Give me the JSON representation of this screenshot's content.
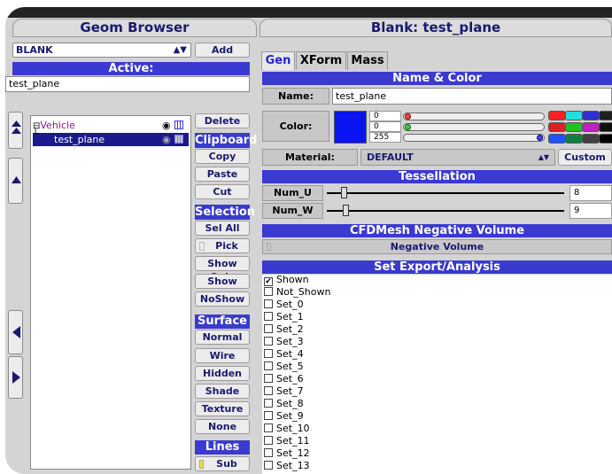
{
  "left_panel": {
    "title": "Geom Browser",
    "type_select": "BLANK",
    "add_label": "Add",
    "active_header": "Active:",
    "active_value": "test_plane",
    "tree": [
      {
        "label": "Vehicle"
      },
      {
        "label": "test_plane"
      }
    ],
    "delete_label": "Delete",
    "clipboard_header": "Clipboard",
    "copy_label": "Copy",
    "paste_label": "Paste",
    "cut_label": "Cut",
    "selection_header": "Selection",
    "sel_all_label": "Sel All",
    "pick_label": "Pick",
    "show_only_label": "Show Only",
    "show_label": "Show",
    "noshow_label": "NoShow",
    "surface_header": "Surface",
    "surface_select": "Normal",
    "wire_label": "Wire",
    "hidden_label": "Hidden",
    "shade_label": "Shade",
    "texture_label": "Texture",
    "none_label": "None",
    "lines_header": "Lines",
    "sub_label": "Sub"
  },
  "right_panel": {
    "title": "Blank: test_plane",
    "tabs": [
      "Gen",
      "XForm",
      "Mass"
    ],
    "name_color_header": "Name & Color",
    "name_label": "Name:",
    "name_value": "test_plane",
    "color_label": "Color:",
    "color_value": "#0a14f0",
    "rgb": [
      "0",
      "0",
      "255"
    ],
    "material_label": "Material:",
    "material_value": "DEFAULT",
    "custom_label": "Custom",
    "tessellation_header": "Tessellation",
    "num_u_label": "Num_U",
    "num_u_value": "8",
    "num_w_label": "Num_W",
    "num_w_value": "9",
    "cfd_header": "CFDMesh Negative Volume",
    "negative_volume_label": "Negative Volume",
    "export_header": "Set Export/Analysis",
    "sets": [
      {
        "label": "Shown",
        "checked": true
      },
      {
        "label": "Not_Shown",
        "checked": false
      },
      {
        "label": "Set_0",
        "checked": false
      },
      {
        "label": "Set_1",
        "checked": false
      },
      {
        "label": "Set_2",
        "checked": false
      },
      {
        "label": "Set_3",
        "checked": false
      },
      {
        "label": "Set_4",
        "checked": false
      },
      {
        "label": "Set_5",
        "checked": false
      },
      {
        "label": "Set_6",
        "checked": false
      },
      {
        "label": "Set_7",
        "checked": false
      },
      {
        "label": "Set_8",
        "checked": false
      },
      {
        "label": "Set_9",
        "checked": false
      },
      {
        "label": "Set_10",
        "checked": false
      },
      {
        "label": "Set_11",
        "checked": false
      },
      {
        "label": "Set_12",
        "checked": false
      },
      {
        "label": "Set_13",
        "checked": false
      }
    ],
    "palette": [
      "#ff2020",
      "#20e0e0",
      "#3030d0",
      "#202020",
      "#e02020",
      "#20c020",
      "#c020c0",
      "#101010",
      "#2050ff",
      "#108040",
      "#404040",
      "#000000"
    ]
  },
  "colors": {
    "accent": "#3a3ad0",
    "title_text": "#1a1a6e",
    "tab_active_text": "#2424c8",
    "panel_bg": "#d4d4d4"
  }
}
